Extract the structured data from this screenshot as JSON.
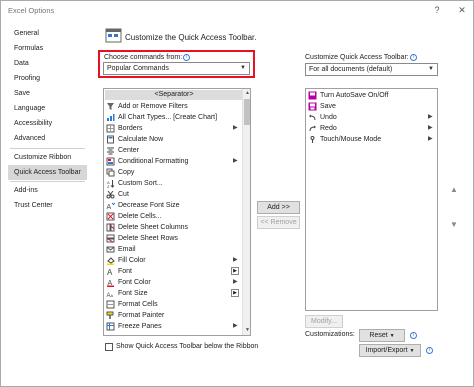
{
  "window": {
    "title": "Excel Options",
    "help": "?",
    "close": "✕"
  },
  "nav": {
    "items": [
      {
        "label": "General"
      },
      {
        "label": "Formulas"
      },
      {
        "label": "Data"
      },
      {
        "label": "Proofing"
      },
      {
        "label": "Save"
      },
      {
        "label": "Language"
      },
      {
        "label": "Accessibility"
      },
      {
        "label": "Advanced"
      },
      {
        "label": "Customize Ribbon"
      },
      {
        "label": "Quick Access Toolbar"
      },
      {
        "label": "Add-ins"
      },
      {
        "label": "Trust Center"
      }
    ],
    "active_index": 9
  },
  "main": {
    "heading": "Customize the Quick Access Toolbar.",
    "choose_label": "Choose commands from:",
    "choose_value": "Popular Commands",
    "customize_label": "Customize Quick Access Toolbar:",
    "customize_value": "For all documents (default)",
    "info_glyph": "i",
    "separator_label": "<Separator>",
    "commands": [
      {
        "label": "Add or Remove Filters",
        "icon": "filter-icon"
      },
      {
        "label": "All Chart Types... [Create Chart]",
        "icon": "chart-icon"
      },
      {
        "label": "Borders",
        "icon": "borders-icon",
        "submenu": "arrow"
      },
      {
        "label": "Calculate Now",
        "icon": "calculator-icon"
      },
      {
        "label": "Center",
        "icon": "center-align-icon"
      },
      {
        "label": "Conditional Formatting",
        "icon": "conditional-formatting-icon",
        "submenu": "arrow"
      },
      {
        "label": "Copy",
        "icon": "copy-icon"
      },
      {
        "label": "Custom Sort...",
        "icon": "sort-icon"
      },
      {
        "label": "Cut",
        "icon": "scissors-icon"
      },
      {
        "label": "Decrease Font Size",
        "icon": "decrease-font-icon"
      },
      {
        "label": "Delete Cells...",
        "icon": "delete-cells-icon"
      },
      {
        "label": "Delete Sheet Columns",
        "icon": "delete-columns-icon"
      },
      {
        "label": "Delete Sheet Rows",
        "icon": "delete-rows-icon"
      },
      {
        "label": "Email",
        "icon": "email-icon"
      },
      {
        "label": "Fill Color",
        "icon": "fill-color-icon",
        "submenu": "arrow"
      },
      {
        "label": "Font",
        "icon": "font-icon",
        "submenu": "box"
      },
      {
        "label": "Font Color",
        "icon": "font-color-icon",
        "submenu": "arrow"
      },
      {
        "label": "Font Size",
        "icon": "font-size-icon",
        "submenu": "box"
      },
      {
        "label": "Format Cells",
        "icon": "format-cells-icon"
      },
      {
        "label": "Format Painter",
        "icon": "format-painter-icon"
      },
      {
        "label": "Freeze Panes",
        "icon": "freeze-panes-icon",
        "submenu": "arrow"
      }
    ],
    "toolbar_items": [
      {
        "label": "Turn AutoSave On/Off",
        "icon": "autosave-icon"
      },
      {
        "label": "Save",
        "icon": "save-icon"
      },
      {
        "label": "Undo",
        "icon": "undo-icon",
        "submenu": "arrow"
      },
      {
        "label": "Redo",
        "icon": "redo-icon",
        "submenu": "arrow"
      },
      {
        "label": "Touch/Mouse Mode",
        "icon": "touch-mode-icon",
        "submenu": "arrow"
      }
    ],
    "add_button": "Add >>",
    "remove_button": "<< Remove",
    "modify_button": "Modify...",
    "customizations_label": "Customizations:",
    "reset_button": "Reset",
    "import_export_button": "Import/Export",
    "show_below_label": "Show Quick Access Toolbar below the Ribbon",
    "colors": {
      "highlight": "#e81123",
      "accent_purple": "#b4009e"
    }
  }
}
